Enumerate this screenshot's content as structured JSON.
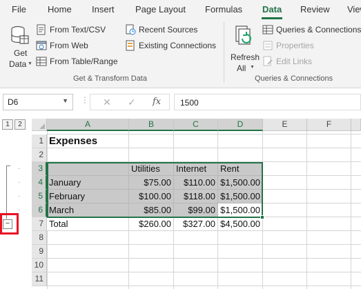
{
  "ribbon_tabs": [
    {
      "label": "File"
    },
    {
      "label": "Home"
    },
    {
      "label": "Insert"
    },
    {
      "label": "Page Layout"
    },
    {
      "label": "Formulas"
    },
    {
      "label": "Data",
      "active": true
    },
    {
      "label": "Review"
    },
    {
      "label": "View"
    }
  ],
  "get_transform": {
    "get_data_line1": "Get",
    "get_data_line2": "Data",
    "from_text_csv": "From Text/CSV",
    "from_web": "From Web",
    "from_table_range": "From Table/Range",
    "recent_sources": "Recent Sources",
    "existing_connections": "Existing Connections",
    "group_label": "Get & Transform Data"
  },
  "queries_connections": {
    "refresh_line1": "Refresh",
    "refresh_line2": "All",
    "queries_connections": "Queries & Connections",
    "properties": "Properties",
    "edit_links": "Edit Links",
    "group_label": "Queries & Connections"
  },
  "formula_bar": {
    "name_box": "D6",
    "cancel_icon": "✕",
    "enter_icon": "✓",
    "fx_label": "fx",
    "value": "1500"
  },
  "outline": {
    "levels": [
      "1",
      "2"
    ],
    "collapse_symbol": "−"
  },
  "columns": [
    "A",
    "B",
    "C",
    "D",
    "E",
    "F"
  ],
  "rows": [
    "1",
    "2",
    "3",
    "4",
    "5",
    "6",
    "7",
    "8",
    "9",
    "10",
    "11"
  ],
  "sheet": {
    "title": "Expenses",
    "headers": [
      "",
      "Utilities",
      "Internet",
      "Rent"
    ],
    "data_rows": [
      [
        "January",
        "$75.00",
        "$110.00",
        "$1,500.00"
      ],
      [
        "February",
        "$100.00",
        "$118.00",
        "$1,500.00"
      ],
      [
        "March",
        "$85.00",
        "$99.00",
        "$1,500.00"
      ]
    ],
    "total_row": [
      "Total",
      "$260.00",
      "$327.00",
      "$4,500.00"
    ]
  },
  "colors": {
    "accent": "#217346",
    "range_fill": "#c9c9c9",
    "highlight": "#e81123"
  }
}
